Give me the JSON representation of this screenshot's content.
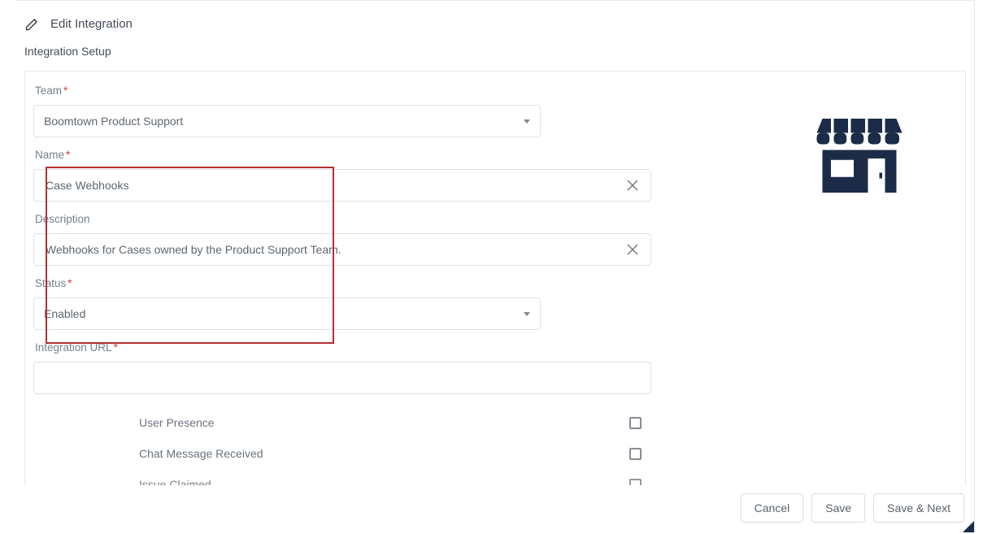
{
  "header": {
    "title": "Edit Integration"
  },
  "subheading": "Integration Setup",
  "fields": {
    "team": {
      "label": "Team",
      "required": true,
      "value": "Boomtown Product Support"
    },
    "name": {
      "label": "Name",
      "required": true,
      "value": "Case Webhooks"
    },
    "description": {
      "label": "Description",
      "required": false,
      "value": "Webhooks for Cases owned by the Product Support Team."
    },
    "status": {
      "label": "Status",
      "required": true,
      "value": "Enabled"
    },
    "url": {
      "label": "Integration URL",
      "required": true,
      "value": ""
    }
  },
  "events": [
    {
      "label": "User Presence",
      "checked": false
    },
    {
      "label": "Chat Message Received",
      "checked": false
    },
    {
      "label": "Issue Claimed",
      "checked": false
    }
  ],
  "footer": {
    "cancel": "Cancel",
    "save": "Save",
    "saveNext": "Save & Next"
  },
  "colors": {
    "brand_navy": "#1c2c48",
    "highlight": "#b53031"
  }
}
